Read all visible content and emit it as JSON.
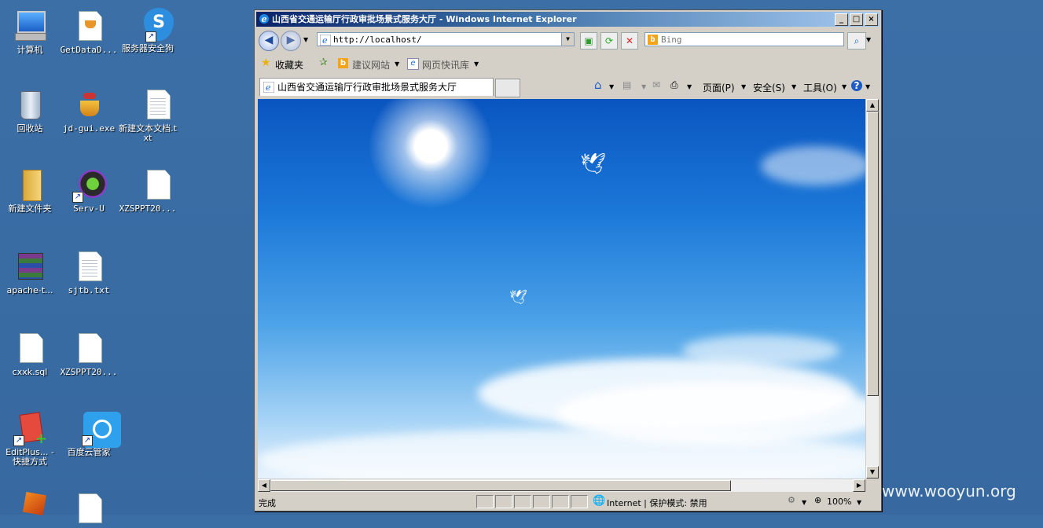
{
  "desktop": {
    "icons": [
      {
        "label": "计算机"
      },
      {
        "label": "GetDataD..."
      },
      {
        "label": "服务器安全狗"
      },
      {
        "label": "回收站"
      },
      {
        "label": "jd-gui.exe"
      },
      {
        "label": "新建文本文档.txt"
      },
      {
        "label": "新建文件夹"
      },
      {
        "label": "Serv-U"
      },
      {
        "label": "XZSPPT20..."
      },
      {
        "label": "apache-t..."
      },
      {
        "label": "sjtb.txt"
      },
      {
        "label": "cxxk.sql"
      },
      {
        "label": "XZSPPT20..."
      },
      {
        "label": "EditPlus... - 快捷方式"
      },
      {
        "label": "百度云管家"
      }
    ]
  },
  "window": {
    "title": "山西省交通运输厅行政审批场景式服务大厅 - Windows Internet Explorer",
    "address": "http://localhost/",
    "search_placeholder": "Bing",
    "favorites": {
      "label": "收藏夹",
      "suggested": "建议网站",
      "slices": "网页快讯库"
    },
    "tab_title": "山西省交通运输厅行政审批场景式服务大厅",
    "commands": {
      "page": "页面(P)",
      "safety": "安全(S)",
      "tools": "工具(O)"
    },
    "status": {
      "left": "完成",
      "zone": "Internet | 保护模式: 禁用",
      "zoom": "100%"
    }
  },
  "watermark": "www.wooyun.org"
}
